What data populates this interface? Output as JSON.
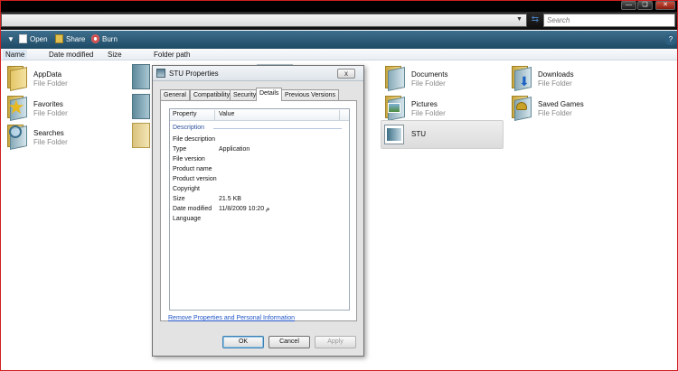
{
  "search": {
    "placeholder": "Search"
  },
  "toolbar": {
    "open_label": "Open",
    "share_label": "Share",
    "burn_label": "Burn",
    "help_label": "?"
  },
  "columns": [
    "Name",
    "Date modified",
    "Size",
    "Folder path"
  ],
  "items": [
    {
      "name": "AppData",
      "type": "File Folder",
      "icon": "folder-icon"
    },
    {
      "name": "Favorites",
      "type": "File Folder",
      "icon": "favorites-star-icon"
    },
    {
      "name": "Searches",
      "type": "File Folder",
      "icon": "search-folder-icon"
    },
    {
      "name": "Documents",
      "type": "File Folder",
      "icon": "documents-folder-icon"
    },
    {
      "name": "Downloads",
      "type": "File Folder",
      "icon": "downloads-folder-icon"
    },
    {
      "name": "Pictures",
      "type": "File Folder",
      "icon": "pictures-folder-icon"
    },
    {
      "name": "Saved Games",
      "type": "File Folder",
      "icon": "saved-games-folder-icon"
    },
    {
      "name": "STU",
      "type": "",
      "icon": "application-icon"
    }
  ],
  "dialog": {
    "title": "STU Properties",
    "close_label": "x",
    "tabs": [
      "General",
      "Compatibility",
      "Security",
      "Details",
      "Previous Versions"
    ],
    "active_tab": "Details",
    "grid": {
      "header_property": "Property",
      "header_value": "Value",
      "group": "Description",
      "rows": [
        {
          "property": "File description",
          "value": ""
        },
        {
          "property": "Type",
          "value": "Application"
        },
        {
          "property": "File version",
          "value": ""
        },
        {
          "property": "Product name",
          "value": ""
        },
        {
          "property": "Product version",
          "value": ""
        },
        {
          "property": "Copyright",
          "value": ""
        },
        {
          "property": "Size",
          "value": "21.5 KB"
        },
        {
          "property": "Date modified",
          "value": "11/8/2009 10:20 م"
        },
        {
          "property": "Language",
          "value": ""
        }
      ]
    },
    "remove_link": "Remove Properties and Personal Information",
    "ok_label": "OK",
    "cancel_label": "Cancel",
    "apply_label": "Apply"
  }
}
